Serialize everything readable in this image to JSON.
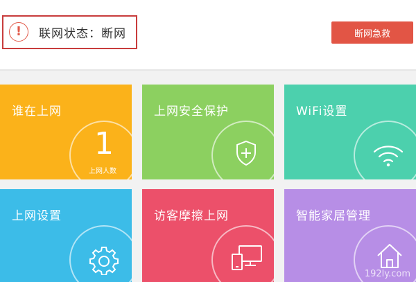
{
  "header": {
    "status_text": "联网状态：断网",
    "alert_symbol": "!",
    "rescue_button": "断网急救",
    "accent_color": "#e25545"
  },
  "tiles": [
    {
      "title": "谁在上网",
      "color": "#fbb21a",
      "count": "1",
      "count_label": "上网人数"
    },
    {
      "title": "上网安全保护",
      "color": "#8cd060",
      "icon": "shield-plus-icon"
    },
    {
      "title": "WiFi设置",
      "color": "#4cd0ad",
      "icon": "wifi-icon"
    },
    {
      "title": "上网设置",
      "color": "#3cbce8",
      "icon": "gear-icon"
    },
    {
      "title": "访客摩擦上网",
      "color": "#ec506a",
      "icon": "guest-device-icon"
    },
    {
      "title": "智能家居管理",
      "color": "#b78ee6",
      "icon": "home-icon"
    }
  ],
  "watermark": "192ly.com"
}
